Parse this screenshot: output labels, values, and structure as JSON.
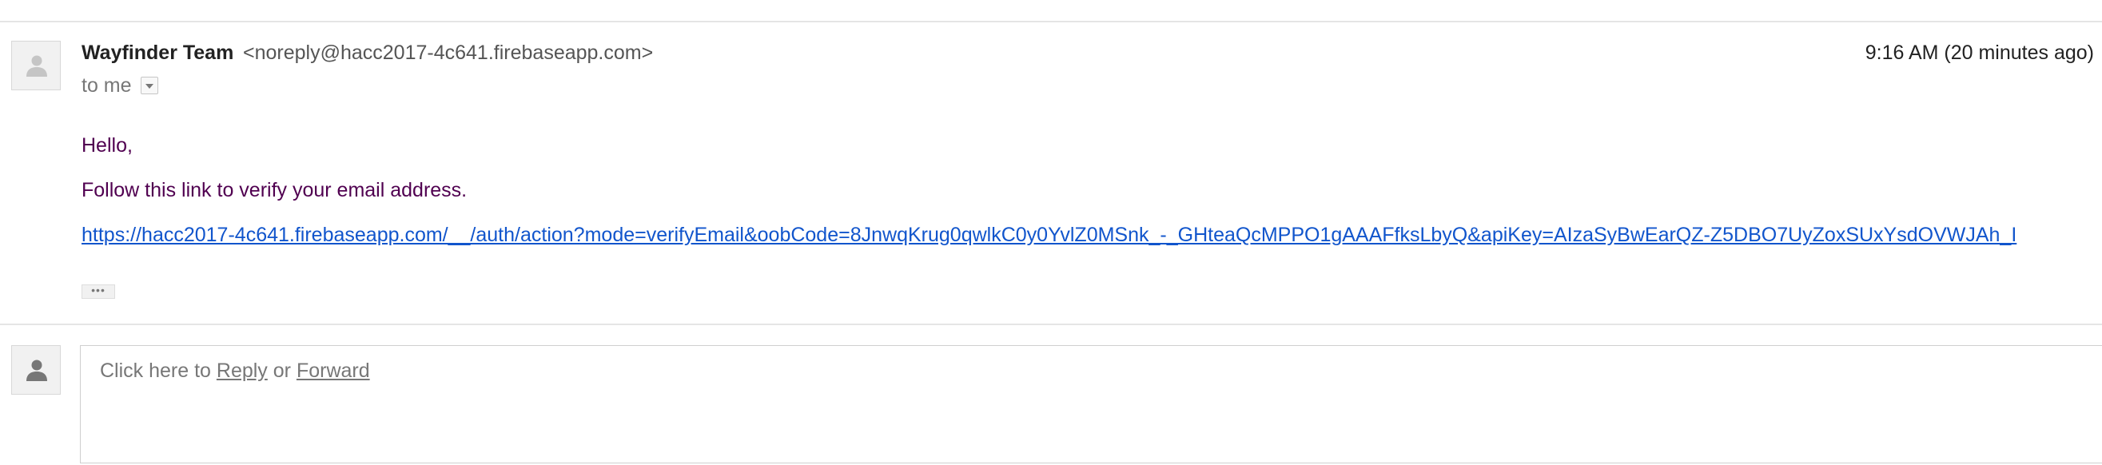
{
  "message": {
    "sender_name": "Wayfinder Team",
    "sender_email": "<noreply@hacc2017-4c641.firebaseapp.com>",
    "timestamp": "9:16 AM (20 minutes ago)",
    "recipient_text": "to me",
    "icons": {
      "sender_avatar": "person-icon",
      "details_toggle": "dropdown-arrow-icon",
      "trimmed_content": "ellipsis-icon"
    },
    "body": {
      "greeting": "Hello,",
      "instruction": "Follow this link to verify your email address.",
      "link": "https://hacc2017-4c641.firebaseapp.com/__/auth/action?mode=verifyEmail&oobCode=8JnwqKrug0qwlkC0y0YvlZ0MSnk_-_GHteaQcMPPO1gAAAFfksLbyQ&apiKey=AIzaSyBwEarQZ-Z5DBO7UyZoxSUxYsdOVWJAh_I"
    },
    "trimmed_label": "•••"
  },
  "reply": {
    "prefix": "Click here to ",
    "reply_label": "Reply",
    "middle": " or ",
    "forward_label": "Forward"
  },
  "colors": {
    "body_text": "#500050",
    "link": "#1155cc",
    "muted": "#777777"
  }
}
